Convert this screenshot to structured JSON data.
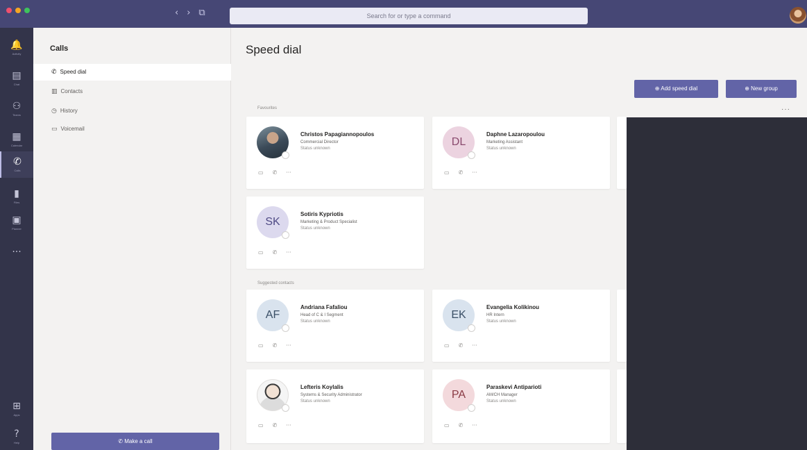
{
  "titlebar": {
    "traffic_colors": [
      "#f0506e",
      "#f5a623",
      "#3ec35c"
    ],
    "nav": [
      "‹",
      "›",
      "⧉"
    ],
    "search_placeholder": "Search for or type a command"
  },
  "rail": {
    "items": [
      {
        "icon": "bell-icon",
        "glyph": "🔔",
        "label": "Activity",
        "active": false
      },
      {
        "icon": "chat-icon",
        "glyph": "▤",
        "label": "Chat",
        "active": false
      },
      {
        "icon": "teams-icon",
        "glyph": "⚇",
        "label": "Teams",
        "active": false
      },
      {
        "icon": "calendar-icon",
        "glyph": "▦",
        "label": "Calendar",
        "active": false
      },
      {
        "icon": "phone-icon",
        "glyph": "✆",
        "label": "Calls",
        "active": true
      },
      {
        "icon": "files-icon",
        "glyph": "▮",
        "label": "Files",
        "active": false
      },
      {
        "icon": "planner-icon",
        "glyph": "▣",
        "label": "Planner",
        "active": false
      },
      {
        "icon": "more-icon",
        "glyph": "···",
        "label": "",
        "active": false
      }
    ],
    "bottom_items": [
      {
        "icon": "apps-icon",
        "glyph": "⊞",
        "label": "Apps"
      },
      {
        "icon": "help-icon",
        "glyph": "?",
        "label": "Help"
      }
    ]
  },
  "left_pane": {
    "title": "Calls",
    "items": [
      {
        "icon": "phone-icon",
        "glyph": "✆",
        "label": "Speed dial",
        "active": true
      },
      {
        "icon": "contacts-icon",
        "glyph": "▥",
        "label": "Contacts",
        "active": false
      },
      {
        "icon": "history-icon",
        "glyph": "◷",
        "label": "History",
        "active": false
      },
      {
        "icon": "voicemail-icon",
        "glyph": "▭",
        "label": "Voicemail",
        "active": false
      }
    ],
    "make_call_label": "✆  Make a call"
  },
  "main": {
    "title": "Speed dial",
    "add_speed_dial_label": "⊕  Add speed dial",
    "new_group_label": "⊕  New group",
    "more_label": "···",
    "favorites_label": "Favourites",
    "suggested_label": "Suggested contacts",
    "favorites": [
      {
        "name": "Christos Papagiannopoulos",
        "role": "Commercial Director",
        "status": "Status unknown",
        "initials": "",
        "avatar_color": "#5b6b78",
        "photo": true
      },
      {
        "name": "Daphne Lazaropoulou",
        "role": "Marketing Assistant",
        "status": "Status unknown",
        "initials": "DL",
        "avatar_color": "#ecd3e0",
        "photo": false
      },
      {
        "name": "Sotiris Kypriotis",
        "role": "Marketing & Product Specialist",
        "status": "Status unknown",
        "initials": "SK",
        "avatar_color": "#dcd9ee",
        "photo": false
      }
    ],
    "suggested": [
      {
        "name": "Andriana Fafaliou",
        "role": "Head of C & I Segment",
        "status": "Status unknown",
        "initials": "AF",
        "avatar_color": "#d9e3ee",
        "photo": false
      },
      {
        "name": "Evangelia Kolikinou",
        "role": "HR Intern",
        "status": "Status unknown",
        "initials": "EK",
        "avatar_color": "#d9e3ee",
        "photo": false
      },
      {
        "name": "Lefteris Koylalis",
        "role": "Systems & Security Administrator",
        "status": "Status unknown",
        "initials": "",
        "avatar_color": "#eeeeee",
        "photo": true
      },
      {
        "name": "Paraskevi Antiparioti",
        "role": "AM/CH Manager",
        "status": "Status unknown",
        "initials": "PA",
        "avatar_color": "#f3d9dc",
        "photo": false
      }
    ],
    "card_actions": [
      "▭",
      "✆",
      "···"
    ]
  },
  "colors": {
    "accent": "#6264a7",
    "titlebar": "#464775",
    "rail": "#33344a",
    "overlay": "#2d2e39"
  }
}
